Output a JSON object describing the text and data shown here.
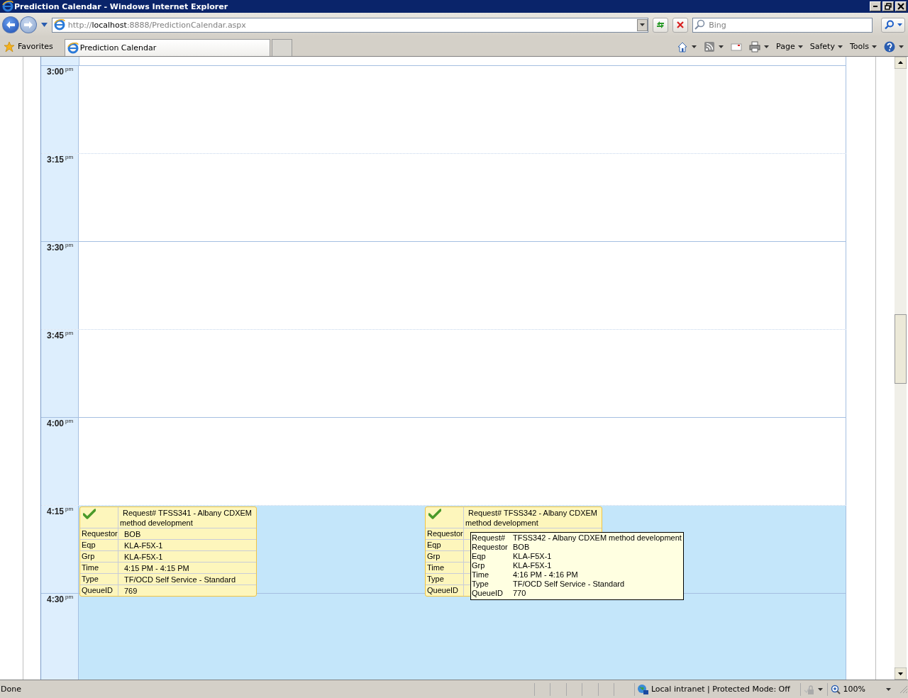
{
  "window": {
    "title": "Prediction Calendar - Windows Internet Explorer"
  },
  "address": {
    "scheme": "http://",
    "host": "localhost",
    "path": ":8888/PredictionCalendar.aspx"
  },
  "search": {
    "placeholder": "Bing"
  },
  "favorites": {
    "label": "Favorites"
  },
  "tabs": [
    {
      "label": "Prediction Calendar",
      "selected": true
    }
  ],
  "commands": [
    {
      "label": "Page"
    },
    {
      "label": "Safety"
    },
    {
      "label": "Tools"
    }
  ],
  "calendar": {
    "slots": [
      {
        "time": "3:00",
        "suffix": "pm",
        "busy": false
      },
      {
        "time": "3:15",
        "suffix": "pm",
        "busy": false
      },
      {
        "time": "3:30",
        "suffix": "pm",
        "busy": false
      },
      {
        "time": "3:45",
        "suffix": "pm",
        "busy": false
      },
      {
        "time": "4:00",
        "suffix": "pm",
        "busy": false
      },
      {
        "time": "4:15",
        "suffix": "pm",
        "busy": true,
        "events": [
          {
            "title": "Request# TFSS341 - Albany CDXEM method development",
            "confirmed": true,
            "fields": [
              {
                "label": "Requestor",
                "value": "BOB"
              },
              {
                "label": "Eqp",
                "value": "KLA-F5X-1"
              },
              {
                "label": "Grp",
                "value": "KLA-F5X-1"
              },
              {
                "label": "Time",
                "value": "4:15 PM - 4:15 PM"
              },
              {
                "label": "Type",
                "value": "TF/OCD Self Service - Standard"
              },
              {
                "label": "QueueID",
                "value": "769"
              }
            ]
          },
          {
            "title": "Request# TFSS342 - Albany CDXEM method development",
            "confirmed": true,
            "fields": [
              {
                "label": "Requestor"
              },
              {
                "label": "Eqp"
              },
              {
                "label": "Grp"
              },
              {
                "label": "Time"
              },
              {
                "label": "Type"
              },
              {
                "label": "QueueID"
              }
            ],
            "tooltip": [
              {
                "label": "Request#",
                "value": "TFSS342 - Albany CDXEM method development"
              },
              {
                "label": "Requestor",
                "value": "BOB"
              },
              {
                "label": "Eqp",
                "value": "KLA-F5X-1"
              },
              {
                "label": "Grp",
                "value": "KLA-F5X-1"
              },
              {
                "label": "Time",
                "value": "4:16 PM - 4:16 PM"
              },
              {
                "label": "Type",
                "value": "TF/OCD Self Service - Standard"
              },
              {
                "label": "QueueID",
                "value": "770"
              }
            ]
          }
        ]
      },
      {
        "time": "4:30",
        "suffix": "pm",
        "busy": true
      }
    ]
  },
  "status_bar": {
    "text": "Done",
    "zone": "Local intranet | Protected Mode: Off",
    "zoom": "100%"
  }
}
